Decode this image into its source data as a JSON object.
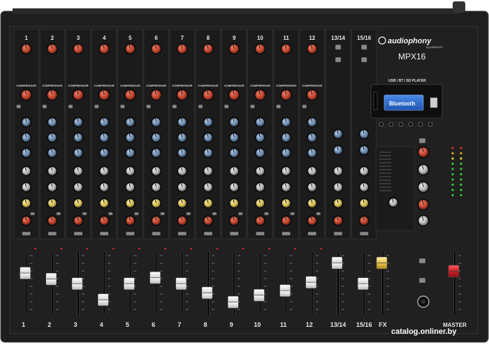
{
  "brand": {
    "name": "audiophony",
    "sub": "EQUIPMENTS",
    "model": "MPX16"
  },
  "player": {
    "title": "USB / BT / SD  PLAYER",
    "display": "Bluetooth"
  },
  "channels": [
    {
      "label": "1",
      "fader": 0.78
    },
    {
      "label": "2",
      "fader": 0.65
    },
    {
      "label": "3",
      "fader": 0.55
    },
    {
      "label": "4",
      "fader": 0.2
    },
    {
      "label": "5",
      "fader": 0.55
    },
    {
      "label": "6",
      "fader": 0.68
    },
    {
      "label": "7",
      "fader": 0.55
    },
    {
      "label": "8",
      "fader": 0.35
    },
    {
      "label": "9",
      "fader": 0.15
    },
    {
      "label": "10",
      "fader": 0.3
    },
    {
      "label": "11",
      "fader": 0.4
    },
    {
      "label": "12",
      "fader": 0.58
    }
  ],
  "stereo_channels": [
    {
      "label": "13/14",
      "fader": 1.0
    },
    {
      "label": "15/16",
      "fader": 0.55
    }
  ],
  "fx": {
    "label": "FX",
    "fader": 1.0
  },
  "master": {
    "label": "MASTER",
    "fader": 0.82
  },
  "compressor_label": "COMPRESSOR",
  "watermark": "catalog.onliner.by",
  "colors": {
    "panel": "#1c1c1c",
    "knob_red": "#c8462e",
    "knob_blue": "#6f8fb4",
    "knob_yellow": "#d8c25a",
    "fader_master": "#d2242a",
    "fader_fx": "#e8c24a",
    "lcd": "#2f6fd0"
  }
}
